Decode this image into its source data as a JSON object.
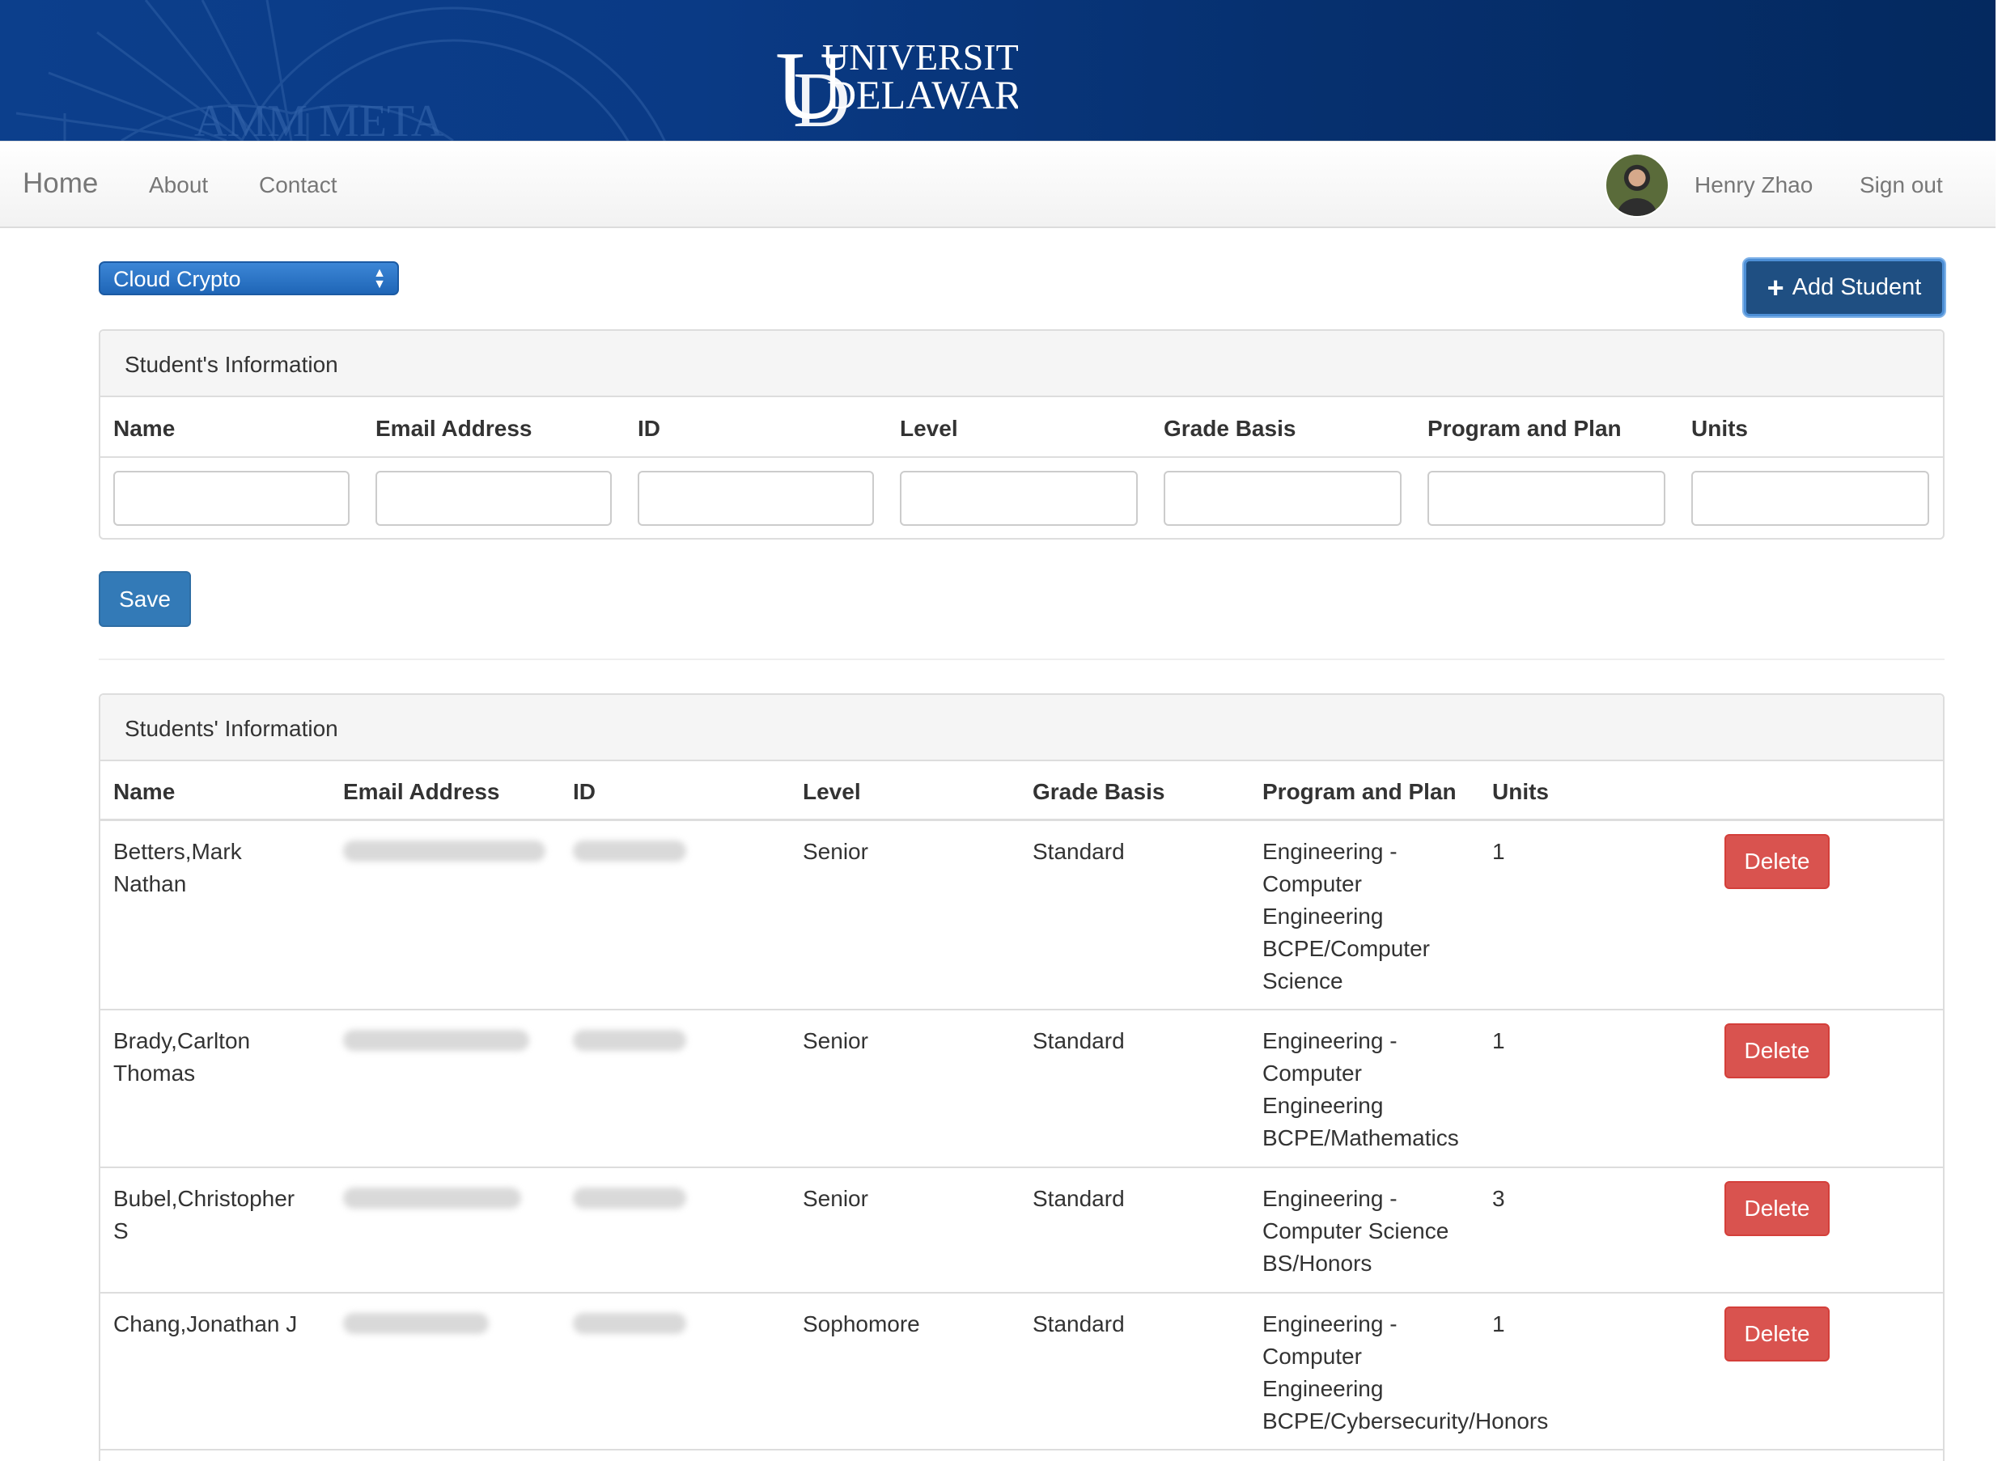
{
  "banner": {
    "logo_text_line1": "UNIVERSITY OF",
    "logo_text_line2": "DELAWARE",
    "seal_text": "AMM META"
  },
  "nav": {
    "home": "Home",
    "about": "About",
    "contact": "Contact",
    "user_name": "Henry Zhao",
    "sign_out": "Sign out"
  },
  "controls": {
    "course_selected": "Cloud Crypto",
    "add_student_label": "Add Student",
    "save_label": "Save"
  },
  "form": {
    "title": "Student's Information",
    "columns": [
      "Name",
      "Email Address",
      "ID",
      "Level",
      "Grade Basis",
      "Program and Plan",
      "Units"
    ]
  },
  "list": {
    "title": "Students' Information",
    "columns": [
      "Name",
      "Email Address",
      "ID",
      "Level",
      "Grade Basis",
      "Program and Plan",
      "Units"
    ],
    "delete_label": "Delete",
    "rows": [
      {
        "name": "Betters,Mark Nathan",
        "level": "Senior",
        "grade": "Standard",
        "plan": "Engineering - Computer Engineering BCPE/Computer Science",
        "units": "1"
      },
      {
        "name": "Brady,Carlton Thomas",
        "level": "Senior",
        "grade": "Standard",
        "plan": "Engineering - Computer Engineering BCPE/Mathematics",
        "units": "1"
      },
      {
        "name": "Bubel,Christopher S",
        "level": "Senior",
        "grade": "Standard",
        "plan": "Engineering - Computer Science BS/Honors",
        "units": "3"
      },
      {
        "name": "Chang,Jonathan J",
        "level": "Sophomore",
        "grade": "Standard",
        "plan": "Engineering - Computer Engineering BCPE/Cybersecurity/Honors",
        "units": "1"
      }
    ]
  },
  "colors": {
    "banner": "#0a3a85",
    "primary": "#337ab7",
    "danger": "#d9534f",
    "add_button": "#1f4f82"
  }
}
